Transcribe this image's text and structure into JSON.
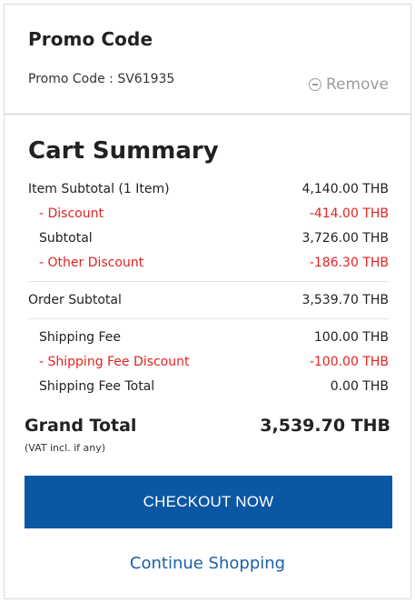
{
  "promo": {
    "title": "Promo Code",
    "code_text": "Promo Code : SV61935",
    "remove_label": "Remove"
  },
  "cart": {
    "title": "Cart Summary",
    "lines": [
      {
        "label": "Item Subtotal (1 Item)",
        "value": "4,140.00 THB",
        "style": "main"
      },
      {
        "label": "- Discount",
        "value": "-414.00 THB",
        "style": "discount"
      },
      {
        "label": "Subtotal",
        "value": "3,726.00 THB",
        "style": "sub"
      },
      {
        "label": "- Other Discount",
        "value": "-186.30 THB",
        "style": "discount"
      }
    ],
    "order_subtotal": {
      "label": "Order Subtotal",
      "value": "3,539.70 THB"
    },
    "shipping": [
      {
        "label": "Shipping Fee",
        "value": "100.00 THB",
        "style": "sub"
      },
      {
        "label": "- Shipping Fee Discount",
        "value": "-100.00 THB",
        "style": "discount"
      },
      {
        "label": "Shipping Fee Total",
        "value": "0.00 THB",
        "style": "sub"
      }
    ],
    "grand_total": {
      "label": "Grand Total",
      "value": "3,539.70 THB",
      "note": "(VAT incl. if any)"
    }
  },
  "actions": {
    "checkout_label": "CHECKOUT NOW",
    "continue_label": "Continue Shopping"
  },
  "colors": {
    "accent": "#0b57a4",
    "discount": "#e32222",
    "link": "#1c5fa6"
  }
}
